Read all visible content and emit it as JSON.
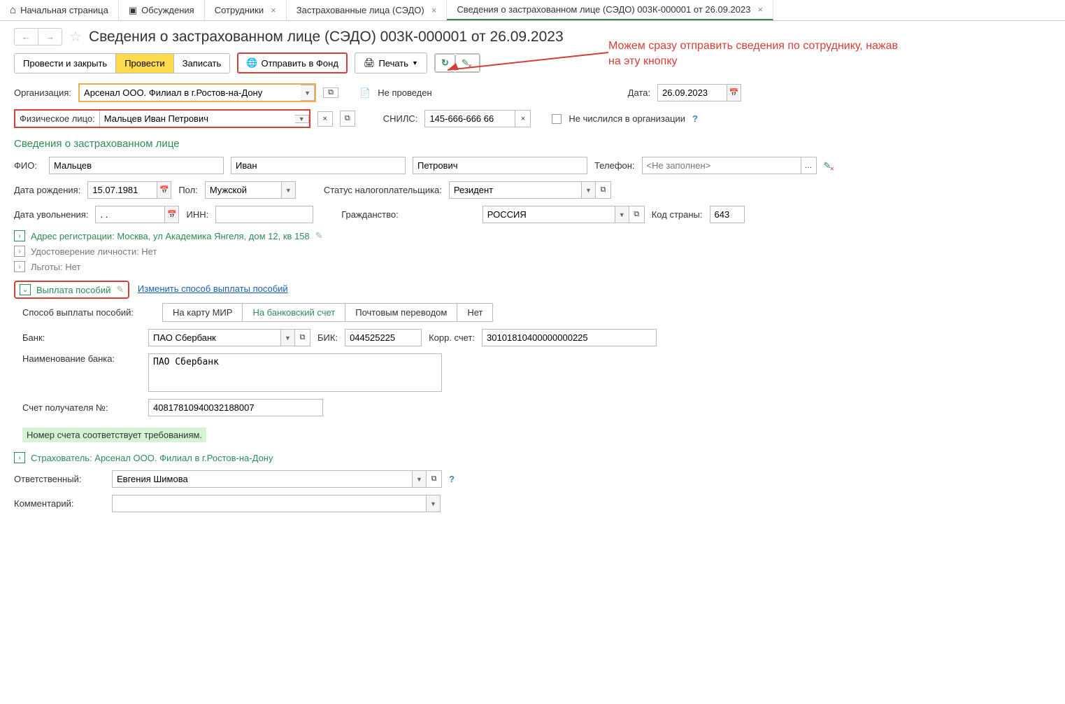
{
  "tabs": [
    {
      "label": "Начальная страница",
      "closable": false,
      "icon": "home"
    },
    {
      "label": "Обсуждения",
      "closable": false,
      "icon": "chat"
    },
    {
      "label": "Сотрудники",
      "closable": true
    },
    {
      "label": "Застрахованные лица (СЭДО)",
      "closable": true
    },
    {
      "label": "Сведения о застрахованном лице (СЭДО) 003К-000001 от 26.09.2023",
      "closable": true,
      "active": true
    }
  ],
  "page_title": "Сведения о застрахованном лице (СЭДО) 003К-000001 от 26.09.2023",
  "toolbar": {
    "post_close": "Провести и закрыть",
    "post": "Провести",
    "save": "Записать",
    "send_fund": "Отправить в Фонд",
    "print": "Печать"
  },
  "form": {
    "org_label": "Организация:",
    "org_value": "Арсенал ООО. Филиал в г.Ростов-на-Дону",
    "not_posted": "Не проведен",
    "date_label": "Дата:",
    "date_value": "26.09.2023",
    "person_label": "Физическое лицо:",
    "person_value": "Мальцев Иван Петрович",
    "snils_label": "СНИЛС:",
    "snils_value": "145-666-666 66",
    "not_in_org": "Не числился в организации"
  },
  "section_insured": "Сведения о застрахованном лице",
  "fio": {
    "label": "ФИО:",
    "last": "Мальцев",
    "first": "Иван",
    "middle": "Петрович",
    "phone_label": "Телефон:",
    "phone_placeholder": "<Не заполнен>"
  },
  "birth": {
    "dob_label": "Дата рождения:",
    "dob_value": "15.07.1981",
    "sex_label": "Пол:",
    "sex_value": "Мужской",
    "tax_label": "Статус налогоплательщика:",
    "tax_value": "Резидент"
  },
  "fire": {
    "date_label": "Дата увольнения:",
    "date_value": ". .",
    "inn_label": "ИНН:",
    "citizenship_label": "Гражданство:",
    "citizenship_value": "РОССИЯ",
    "country_code_label": "Код страны:",
    "country_code_value": "643"
  },
  "expandables": {
    "address": "Адрес регистрации: Москва, ул Академика Янгеля, дом 12, кв 158",
    "identity": "Удостоверение личности: Нет",
    "benefits": "Льготы: Нет",
    "payout": "Выплата пособий",
    "change_method": "Изменить способ выплаты пособий",
    "insurer": "Страхователь: Арсенал ООО. Филиал в г.Ростов-на-Дону"
  },
  "payout": {
    "method_label": "Способ выплаты пособий:",
    "seg1": "На карту МИР",
    "seg2": "На банковский счет",
    "seg3": "Почтовым переводом",
    "seg4": "Нет",
    "bank_label": "Банк:",
    "bank_value": "ПАО Сбербанк",
    "bik_label": "БИК:",
    "bik_value": "044525225",
    "corr_label": "Корр. счет:",
    "corr_value": "30101810400000000225",
    "bank_name_label": "Наименование банка:",
    "bank_name_value": "ПАО Сбербанк",
    "account_label": "Счет получателя №:",
    "account_value": "40817810940032188007",
    "status_ok": "Номер счета соответствует требованиям."
  },
  "footer": {
    "responsible_label": "Ответственный:",
    "responsible_value": "Евгения Шимова",
    "comment_label": "Комментарий:"
  },
  "annotation": "Можем сразу отправить сведения по сотруднику, нажав на эту кнопку"
}
